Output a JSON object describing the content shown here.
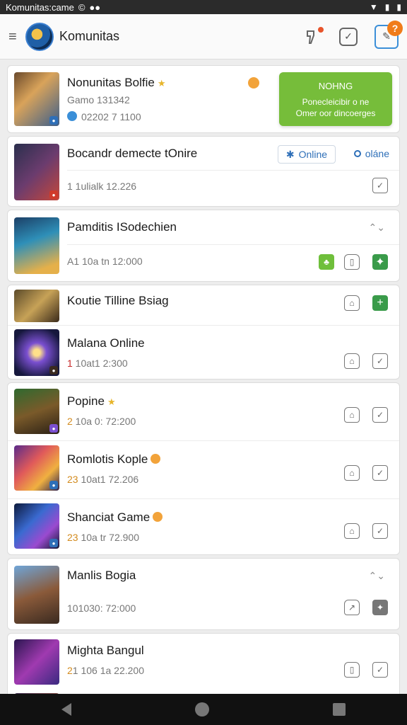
{
  "status_bar": {
    "title": "Komunitas:came",
    "icons": [
      "c-icon",
      "chat-icon",
      "wifi-icon",
      "battery-icon"
    ]
  },
  "app_bar": {
    "title": "Komunitas",
    "badge_question": "?"
  },
  "promo": {
    "title": "NOHNG",
    "line1": "Ponecleicibir o ne",
    "line2": "Omer oor dincoerges"
  },
  "items": [
    {
      "name": "Nonunitas Bolfie",
      "meta": "Gamo 131342",
      "sub": "02202 7 1100"
    },
    {
      "name": "Bocandr demecte tOnire",
      "meta": "1 1ulialk 12.226",
      "online_btn": "Online",
      "online_link": "oláne"
    },
    {
      "name": "Pamditis ISodechien",
      "meta": "A1 10a tn 12:000"
    },
    {
      "name": "Koutie Tilline Bsiag"
    },
    {
      "name": "Malana Online",
      "meta_red": "1",
      "meta": " 10at1 2:300"
    },
    {
      "name": "Popine",
      "meta_hl": "2",
      "meta": " 10a 0: 72:200"
    },
    {
      "name": "Romlotis Kople",
      "meta_hl": "23",
      "meta": " 10at1 72.206"
    },
    {
      "name": "Shanciat Game",
      "meta_hl": "23",
      "meta": " 10a tr 72.900"
    },
    {
      "name": "Manlis Bogia",
      "meta": "101030: 72:000"
    },
    {
      "name": "Mighta Bangul",
      "meta_hl": "2",
      "meta": "1 106 1a 22.200"
    }
  ]
}
